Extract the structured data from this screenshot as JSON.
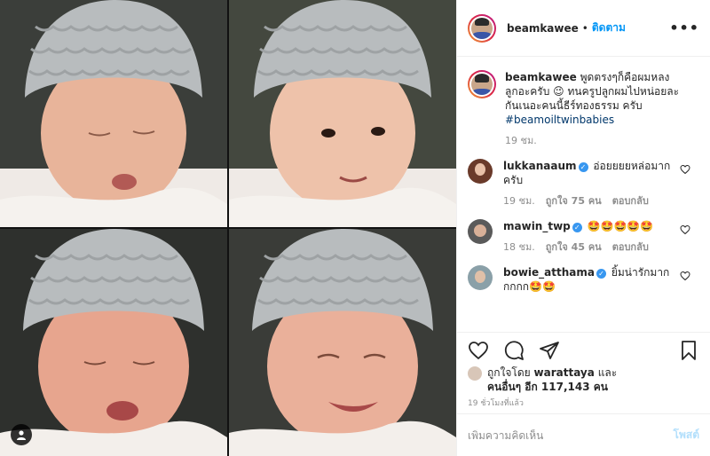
{
  "header": {
    "username": "beamkawee",
    "separator": "•",
    "follow_label": "ติดตาม",
    "more_icon": "more-horizontal-icon"
  },
  "caption": {
    "username": "beamkawee",
    "text": "พูดตรงๆก็คือผมหลงลูกอะครับ 😉 ทนครูปลูกผมไปหน่อยละกันเนอะคนนี้ธีร์ทองธรรม ครับ",
    "hashtag": "#beamoiltwinbabies",
    "time": "19 ชม."
  },
  "comments": [
    {
      "username": "lukkanaaum",
      "verified": true,
      "text": "อ่อยยยยหล่อมากครับ",
      "time": "19 ชม.",
      "likes": "ถูกใจ 75 คน",
      "reply": "ตอบกลับ"
    },
    {
      "username": "mawin_twp",
      "verified": true,
      "text": "🤩🤩🤩🤩🤩",
      "time": "18 ชม.",
      "likes": "ถูกใจ 45 คน",
      "reply": "ตอบกลับ"
    },
    {
      "username": "bowie_atthama",
      "verified": true,
      "text": "ยิ้มน่ารักมากกกกก🤩🤩"
    }
  ],
  "likes": {
    "prefix": "ถูกใจโดย",
    "user": "warattaya",
    "and": "และ",
    "others": "คนอื่นๆ อีก 117,143 คน"
  },
  "time_ago": "19 ชั่วโมงที่แล้ว",
  "add_comment": {
    "placeholder": "เพิ่มความคิดเห็น",
    "post_label": "โพสต์"
  },
  "colors": {
    "accent": "#0095f6",
    "verified": "#3897f0",
    "hat": "#b9bcbe",
    "skin": "#e9b8a0"
  }
}
